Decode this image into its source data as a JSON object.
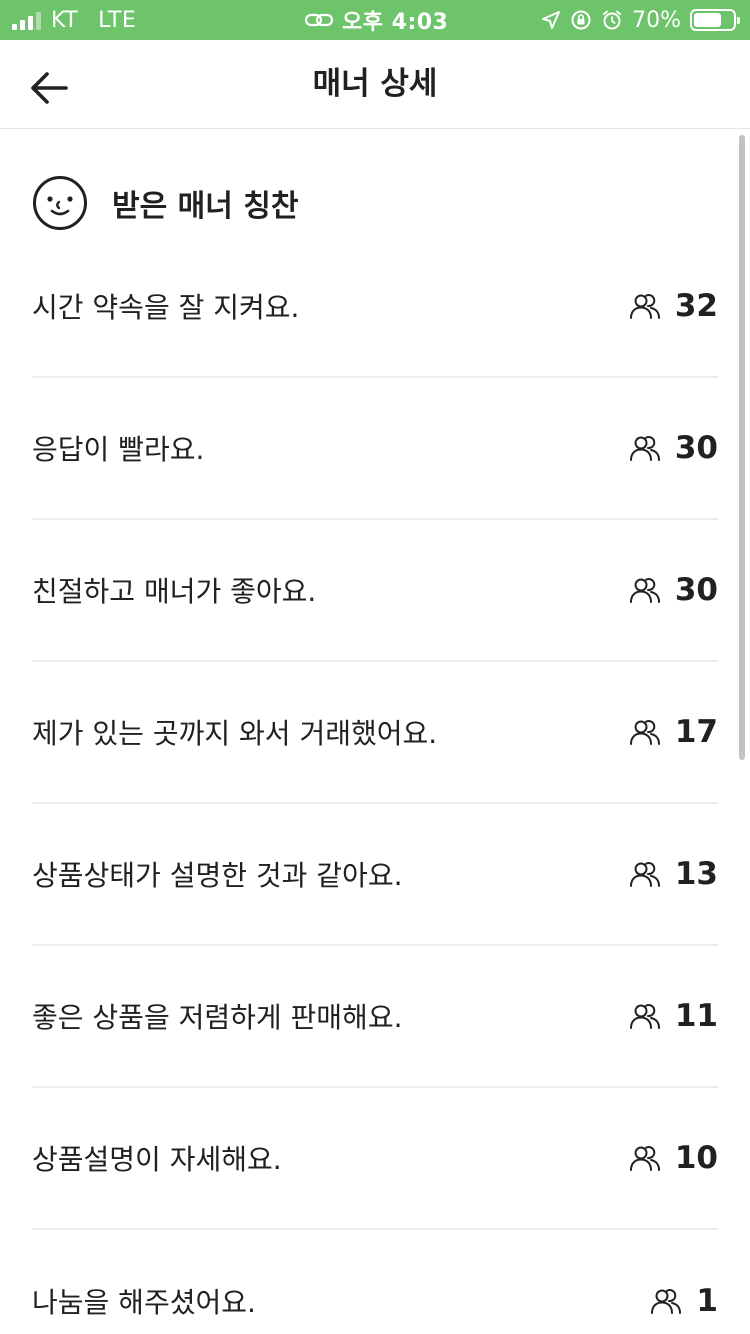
{
  "status_bar": {
    "carrier": "KT",
    "network": "LTE",
    "time": "오후 4:03",
    "battery_percent": "70%",
    "battery_level": 0.7
  },
  "nav": {
    "title": "매너 상세",
    "back_icon": "arrow-left-icon"
  },
  "section": {
    "icon": "smiley-face-icon",
    "title": "받은 매너 칭찬"
  },
  "manner_items": [
    {
      "label": "시간 약속을 잘 지켜요.",
      "count": "32"
    },
    {
      "label": "응답이 빨라요.",
      "count": "30"
    },
    {
      "label": "친절하고 매너가 좋아요.",
      "count": "30"
    },
    {
      "label": "제가 있는 곳까지 와서 거래했어요.",
      "count": "17"
    },
    {
      "label": "상품상태가 설명한 것과 같아요.",
      "count": "13"
    },
    {
      "label": "좋은 상품을 저렴하게 판매해요.",
      "count": "11"
    },
    {
      "label": "상품설명이 자세해요.",
      "count": "10"
    },
    {
      "label": "나눔을 해주셨어요.",
      "count": "1"
    }
  ],
  "colors": {
    "status_bar": "#6ec46a",
    "text": "#212124",
    "divider": "#ececec"
  }
}
